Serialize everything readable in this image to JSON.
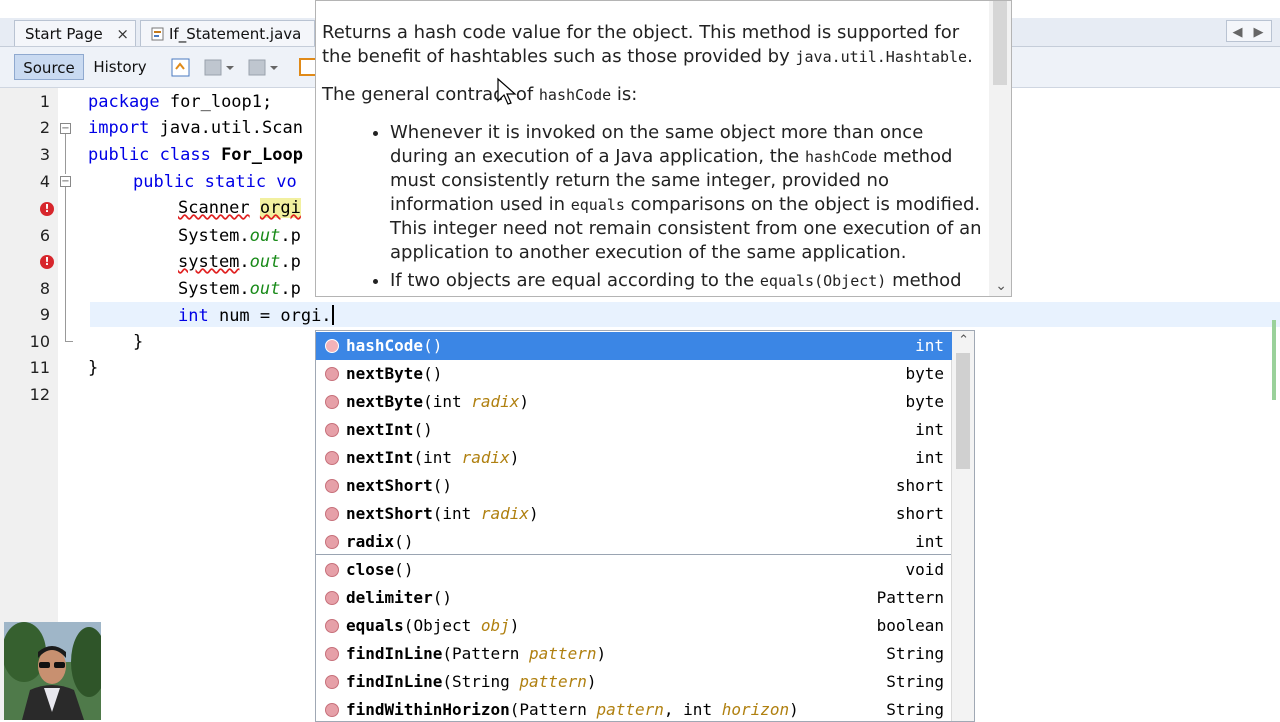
{
  "tabs": [
    {
      "label": "Start Page",
      "close": "×"
    },
    {
      "label": "If_Statement.java",
      "close": "×"
    }
  ],
  "toolbar": {
    "source_label": "Source",
    "history_label": "History"
  },
  "nav": {
    "left": "◀",
    "right": "▶"
  },
  "editor": {
    "lines": [
      "1",
      "2",
      "3",
      "4",
      "5",
      "6",
      "7",
      "8",
      "9",
      "10",
      "11",
      "12"
    ],
    "code": {
      "l1_kw": "package",
      "l1_rest": " for_loop1;",
      "l2_kw": "import",
      "l2_rest": " java.util.Scan",
      "l3_kw": "public class",
      "l3_rest": " For_Loop",
      "l4_kw": "public static",
      "l4_rest": " vo",
      "l5_type": "Scanner",
      "l5_var": "orgi",
      "l6_a": "System.",
      "l6_b": "out",
      "l6_c": ".p",
      "l7_a": "system",
      "l7_b": ".",
      "l7_c": "out",
      "l7_d": ".p",
      "l8_a": "System.",
      "l8_b": "out",
      "l8_c": ".p",
      "l9_kw": "int",
      "l9_rest": " num = orgi.",
      "l10": "}",
      "l11": "}"
    }
  },
  "javadoc": {
    "p1_a": "Returns a hash code value for the object. This method is supported for the benefit of hashtables such as those provided by ",
    "p1_code": "java.util.Hashtable",
    "p1_b": ".",
    "p2_a": "The general contract of ",
    "p2_code": "hashCode",
    "p2_b": " is:",
    "li1_a": "Whenever it is invoked on the same object more than once during an execution of a Java application, the ",
    "li1_code1": "hashCode",
    "li1_b": " method must consistently return the same integer, provided no information used in ",
    "li1_code2": "equals",
    "li1_c": " comparisons on the object is modified. This integer need not remain consistent from one execution of an application to another execution of the same application.",
    "li2_a": "If two objects are equal according to the ",
    "li2_code": "equals(Object)",
    "li2_b": " method"
  },
  "completion": {
    "items": [
      {
        "name": "hashCode",
        "open": "(",
        "params": [],
        "close": ")",
        "type": "int"
      },
      {
        "name": "nextByte",
        "open": "(",
        "params": [],
        "close": ")",
        "type": "byte"
      },
      {
        "name": "nextByte",
        "open": "(",
        "ptype": "int ",
        "pname": "radix",
        "close": ")",
        "type": "byte"
      },
      {
        "name": "nextInt",
        "open": "(",
        "close": ")",
        "type": "int"
      },
      {
        "name": "nextInt",
        "open": "(",
        "ptype": "int ",
        "pname": "radix",
        "close": ")",
        "type": "int"
      },
      {
        "name": "nextShort",
        "open": "(",
        "close": ")",
        "type": "short"
      },
      {
        "name": "nextShort",
        "open": "(",
        "ptype": "int ",
        "pname": "radix",
        "close": ")",
        "type": "short"
      },
      {
        "name": "radix",
        "open": "(",
        "close": ")",
        "type": "int"
      },
      {
        "name": "close",
        "open": "(",
        "close": ")",
        "type": "void"
      },
      {
        "name": "delimiter",
        "open": "(",
        "close": ")",
        "type": "Pattern"
      },
      {
        "name": "equals",
        "open": "(",
        "ptype": "Object ",
        "pname": "obj",
        "close": ")",
        "type": "boolean"
      },
      {
        "name": "findInLine",
        "open": "(",
        "ptype": "Pattern ",
        "pname": "pattern",
        "close": ")",
        "type": "String"
      },
      {
        "name": "findInLine",
        "open": "(",
        "ptype": "String ",
        "pname": "pattern",
        "close": ")",
        "type": "String"
      },
      {
        "name": "findWithinHorizon",
        "open": "(",
        "ptype": "Pattern ",
        "pname": "pattern",
        "ptype2": ", int ",
        "pname2": "horizon",
        "close": ")",
        "type": "String"
      }
    ]
  },
  "colors": {
    "selection": "#3b86e5",
    "keyword": "#0000e6",
    "error": "#d7262c"
  }
}
